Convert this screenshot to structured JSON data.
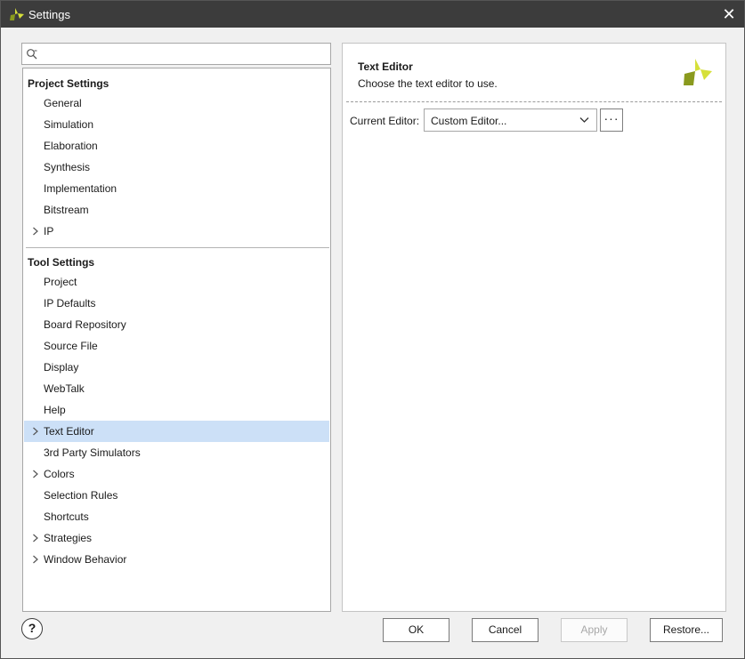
{
  "window": {
    "title": "Settings",
    "close_glyph": "✕",
    "app_icon": "vivado-logo-icon"
  },
  "search": {
    "placeholder": "",
    "value": ""
  },
  "tree": {
    "project_settings_header": "Project Settings",
    "project_settings_items": [
      {
        "label": "General",
        "expandable": false
      },
      {
        "label": "Simulation",
        "expandable": false
      },
      {
        "label": "Elaboration",
        "expandable": false
      },
      {
        "label": "Synthesis",
        "expandable": false
      },
      {
        "label": "Implementation",
        "expandable": false
      },
      {
        "label": "Bitstream",
        "expandable": false
      },
      {
        "label": "IP",
        "expandable": true
      }
    ],
    "tool_settings_header": "Tool Settings",
    "tool_settings_items": [
      {
        "label": "Project",
        "expandable": false
      },
      {
        "label": "IP Defaults",
        "expandable": false
      },
      {
        "label": "Board Repository",
        "expandable": false
      },
      {
        "label": "Source File",
        "expandable": false
      },
      {
        "label": "Display",
        "expandable": false
      },
      {
        "label": "WebTalk",
        "expandable": false
      },
      {
        "label": "Help",
        "expandable": false
      },
      {
        "label": "Text Editor",
        "expandable": true,
        "selected": true
      },
      {
        "label": "3rd Party Simulators",
        "expandable": false
      },
      {
        "label": "Colors",
        "expandable": true
      },
      {
        "label": "Selection Rules",
        "expandable": false
      },
      {
        "label": "Shortcuts",
        "expandable": false
      },
      {
        "label": "Strategies",
        "expandable": true
      },
      {
        "label": "Window Behavior",
        "expandable": true
      }
    ],
    "selected_color": "#cce0f7"
  },
  "panel": {
    "title": "Text Editor",
    "description": "Choose the text editor to use.",
    "current_editor_label": "Current Editor:",
    "current_editor_value": "Custom Editor...",
    "more_button": "···"
  },
  "footer": {
    "help": "?",
    "ok": "OK",
    "cancel": "Cancel",
    "apply": "Apply",
    "restore": "Restore..."
  },
  "colors": {
    "titlebar": "#3c3c3c",
    "logo_yellow": "#d6e03a",
    "logo_olive": "#8a9a1e"
  }
}
